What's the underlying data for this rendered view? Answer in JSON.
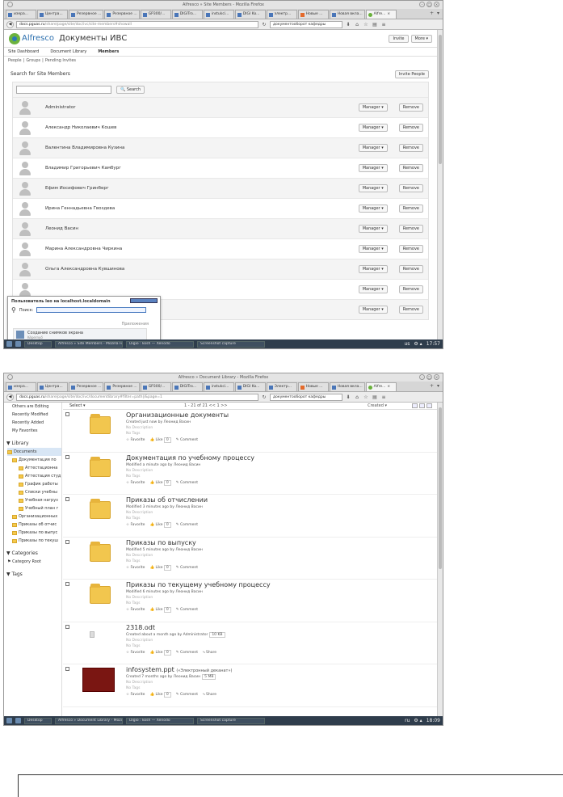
{
  "shot1": {
    "window_title": "Alfresco » Site Members - Mozilla Firefox",
    "tabs": [
      {
        "label": "изера...",
        "icon": "page-icon"
      },
      {
        "label": "Центра...",
        "icon": "page-icon"
      },
      {
        "label": "Резервное ...",
        "icon": "page-icon"
      },
      {
        "label": "Резервное ...",
        "icon": "page-icon"
      },
      {
        "label": "GP300/...",
        "icon": "page-icon"
      },
      {
        "label": "DIGITro...",
        "icon": "page-icon"
      },
      {
        "label": "instukci...",
        "icon": "page-icon"
      },
      {
        "label": "DIGI Ko...",
        "icon": "page-icon"
      },
      {
        "label": "электр...",
        "icon": "page-icon"
      },
      {
        "label": "Новые ...",
        "icon": "firefox-icon"
      },
      {
        "label": "Новая вкла...",
        "icon": "page-icon"
      },
      {
        "label": "Alfre...",
        "icon": "alfresco-icon",
        "active": true
      }
    ],
    "url_domain": "docs.pguas.ru",
    "url_path": "/share/page/site/doc/ivc/site-members#showall",
    "search_value": "документооборот кафедры",
    "site_title": "Документы ИВС",
    "header_buttons": {
      "invite": "Invite",
      "more": "More ▾"
    },
    "site_nav": [
      "Site Dashboard",
      "Document Library",
      "Members"
    ],
    "sub_nav": [
      "People",
      "|",
      "Groups",
      "|",
      "Pending Invites"
    ],
    "search_heading": "Search for Site Members",
    "invite_people": "Invite People",
    "search_button": "Search",
    "role_label": "Manager ▾",
    "remove_label": "Remove",
    "members": [
      "Administrator",
      "Александр Николаевич Кошев",
      "Валентина Владимировна Кузина",
      "Владимир Григорьевич Камбург",
      "Ефим Иосифович Гринберг",
      "Ирина Геннадьевна Гвоздева",
      "Леонид Васин",
      "Марина Александровна Чиркина",
      "Ольга Александровна Кувшинова",
      "",
      ""
    ],
    "popup": {
      "title": "Пользователь leo на localhost.localdomain",
      "search_label": "Поиск:",
      "apps_label": "Приложения",
      "item_label": "Создание снимков экрана",
      "item_sub": "Képernyő"
    },
    "taskbar": {
      "tasks": [
        "Desktop",
        "Alfresco » Site Members - Mozilla Firefox",
        "Digio : kosh — Xenodo",
        "Screenshot capture"
      ],
      "lang": "us",
      "time": "17:57"
    }
  },
  "shot2": {
    "window_title": "Alfresco » Document Library - Mozilla Firefox",
    "tabs": [
      {
        "label": "изера...",
        "icon": "page-icon"
      },
      {
        "label": "Центра...",
        "icon": "page-icon"
      },
      {
        "label": "Резервное ...",
        "icon": "page-icon"
      },
      {
        "label": "Резервное ...",
        "icon": "page-icon"
      },
      {
        "label": "GP300/...",
        "icon": "page-icon"
      },
      {
        "label": "DIGITro...",
        "icon": "page-icon"
      },
      {
        "label": "instukci...",
        "icon": "page-icon"
      },
      {
        "label": "DIGI Ko...",
        "icon": "page-icon"
      },
      {
        "label": "Электр...",
        "icon": "page-icon"
      },
      {
        "label": "Новые ...",
        "icon": "firefox-icon"
      },
      {
        "label": "Новая вкла...",
        "icon": "page-icon"
      },
      {
        "label": "Alfre...",
        "icon": "alfresco-icon",
        "active": true
      }
    ],
    "url_domain": "docs.pguas.ru",
    "url_path": "/share/page/site/doc/ivc/documentlibrary#filter=path|/&page=1",
    "search_value": "документооборот кафедры",
    "filters": [
      "Others are Editing",
      "Recently Modified",
      "Recently Added",
      "My Favorites"
    ],
    "library_heading": "▼ Library",
    "tree": [
      {
        "label": "Documents",
        "level": 0,
        "selected": true
      },
      {
        "label": "Документация по",
        "level": 1
      },
      {
        "label": "Аттестационна",
        "level": 2
      },
      {
        "label": "Аттестация студ",
        "level": 2
      },
      {
        "label": "График работы",
        "level": 2
      },
      {
        "label": "Списки учебны",
        "level": 2
      },
      {
        "label": "Учебная нагруз",
        "level": 2
      },
      {
        "label": "Учебный план г",
        "level": 2
      },
      {
        "label": "Организационных",
        "level": 1
      },
      {
        "label": "Приказы об отчис",
        "level": 1
      },
      {
        "label": "Приказы по выпус",
        "level": 1
      },
      {
        "label": "Приказы по текуш",
        "level": 1
      }
    ],
    "categories_heading": "▼ Categories",
    "category_root": "Category Root",
    "tags_heading": "▼ Tags",
    "toolbar": {
      "select": "Select ▾",
      "paging": "1 - 21 of 21   <<   1   >>",
      "sort": "Created ▾"
    },
    "no_description": "No Description",
    "no_tags": "No Tags",
    "favorite": "Favorite",
    "like": "Like",
    "like_count": "0",
    "comment": "Comment",
    "share": "Share",
    "documents": [
      {
        "name": "Организационные документы",
        "subtitle": "",
        "meta": "Created just now by Леонид Васин",
        "size": "",
        "kind": "folder",
        "share": false
      },
      {
        "name": "Документация по учебному процессу",
        "subtitle": "",
        "meta": "Modified a minute ago by Леонид Васин",
        "size": "",
        "kind": "folder",
        "share": false
      },
      {
        "name": "Приказы об отчислении",
        "subtitle": "",
        "meta": "Modified 3 minutes ago by Леонид Васин",
        "size": "",
        "kind": "folder",
        "share": false
      },
      {
        "name": "Приказы по выпуску",
        "subtitle": "",
        "meta": "Modified 5 minutes ago by Леонид Васин",
        "size": "",
        "kind": "folder",
        "share": false
      },
      {
        "name": "Приказы по текущему учебному процессу",
        "subtitle": "",
        "meta": "Modified 6 minutes ago by Леонид Васин",
        "size": "",
        "kind": "folder",
        "share": false
      },
      {
        "name": "2318.odt",
        "subtitle": "",
        "meta": "Created about a month ago by Administrator",
        "size": "10 KB",
        "kind": "file",
        "share": true
      },
      {
        "name": "infosystem.ppt",
        "subtitle": "(«Электронный деканат»)",
        "meta": "Created 7 months ago by Леонид Васин",
        "size": "5 MB",
        "kind": "ppt",
        "share": true
      }
    ],
    "taskbar": {
      "tasks": [
        "Desktop",
        "Alfresco » Document Library - Mozil",
        "Digio : kosh — Xenodo",
        "Screenshot capture"
      ],
      "lang": "ru",
      "time": "18:09"
    }
  }
}
